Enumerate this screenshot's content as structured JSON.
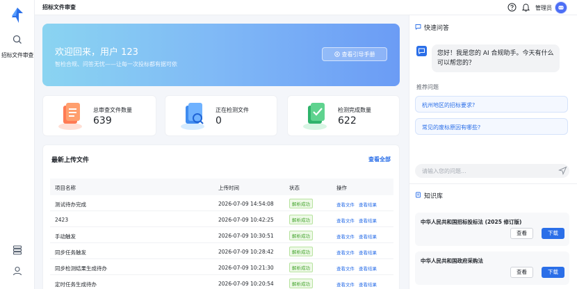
{
  "app": {
    "title": "招标文件审查"
  },
  "rail": {
    "nav_label": "招标文件审查"
  },
  "topbar": {
    "user": "管理员"
  },
  "banner": {
    "welcome": "欢迎回来，用户 123",
    "subtitle": "智检合规、问答无忧——让每一次投标都有据可依",
    "guide_button": "查看引导手册"
  },
  "stats": [
    {
      "label": "总审查文件数量",
      "value": "639"
    },
    {
      "label": "正在检测文件",
      "value": "0"
    },
    {
      "label": "检测完成数量",
      "value": "622"
    }
  ],
  "files": {
    "title": "最新上传文件",
    "view_all": "查看全部",
    "columns": [
      "项目名称",
      "上传时间",
      "状态",
      "操作"
    ],
    "op_view": "查看文件",
    "op_result": "查看结果",
    "rows": [
      {
        "name": "测试待办完成",
        "time": "2026-07-09 14:54:08",
        "status": "解析成功"
      },
      {
        "name": "2423",
        "time": "2026-07-09 10:42:25",
        "status": "解析成功"
      },
      {
        "name": "手动触发",
        "time": "2026-07-09 10:30:51",
        "status": "解析成功"
      },
      {
        "name": "同步任务触发",
        "time": "2026-07-09 10:28:42",
        "status": "解析成功"
      },
      {
        "name": "同步检测结果生成待办",
        "time": "2026-07-09 10:21:30",
        "status": "解析成功"
      },
      {
        "name": "定时任务生成待办",
        "time": "2026-07-09 10:20:54",
        "status": "解析成功"
      }
    ]
  },
  "qa": {
    "title": "快速问答",
    "greeting": "您好！我是您的 AI 合规助手。今天有什么可以帮您的？",
    "recommend_title": "推荐问题",
    "questions": [
      "杭州地区的招标要求?",
      "常见的废标原因有哪些?"
    ],
    "input_placeholder": "请输入您的问题..."
  },
  "kb": {
    "title": "知识库",
    "view_label": "查看",
    "download_label": "下载",
    "items": [
      {
        "title": "中华人民共和国招标投标法 (2025 修订版)"
      },
      {
        "title": "中华人民共和国政府采购法"
      }
    ]
  },
  "colors": {
    "accent": "#2b6fe8",
    "success": "#45a52f",
    "banner_start": "#8ad4f1",
    "banner_end": "#6b9cf5"
  }
}
